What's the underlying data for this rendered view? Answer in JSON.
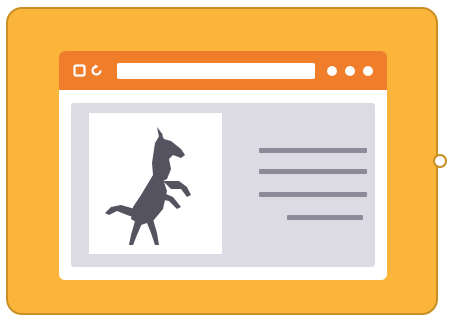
{
  "tablet": {
    "frame_color": "#fbb53a",
    "border_color": "#c98f22",
    "home_button_color": "#ffffff"
  },
  "browser": {
    "titlebar_color": "#f07d2a",
    "window_icons": [
      "square-icon",
      "refresh-icon"
    ],
    "address_bar": "",
    "menu_dots": 3,
    "content_panel_color": "#dcdbe3",
    "image": {
      "icon": "rearing-horse-icon",
      "color": "#55535f"
    },
    "text_placeholder_lines": 4,
    "text_line_color": "#8c8b9a"
  }
}
